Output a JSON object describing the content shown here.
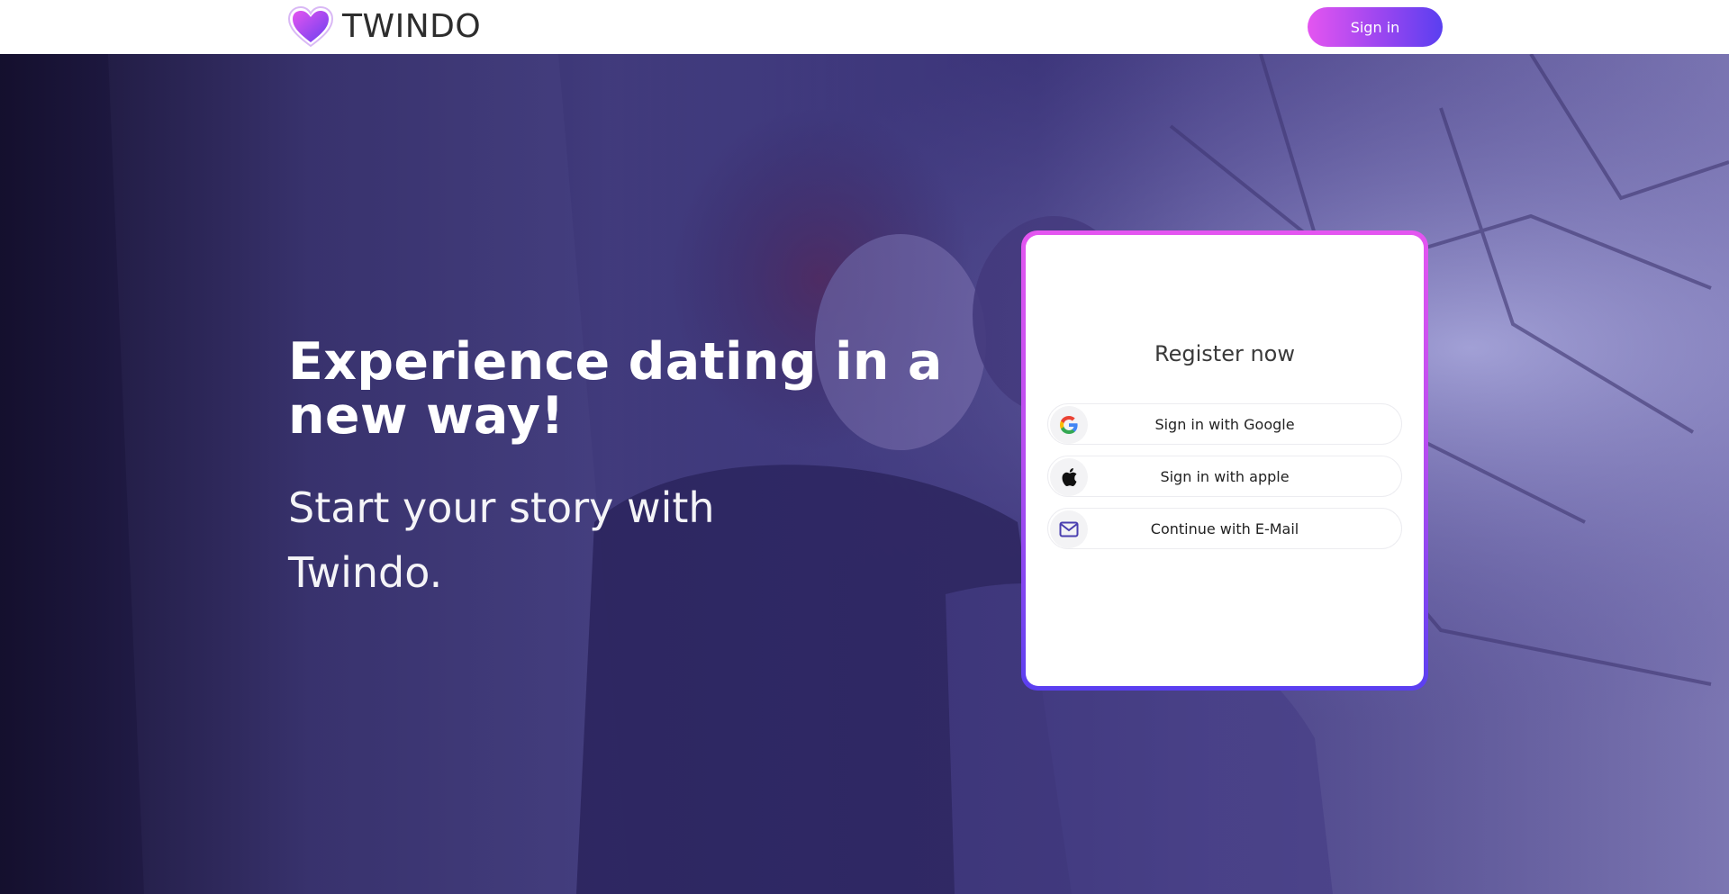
{
  "header": {
    "brand_name": "TWINDO",
    "logo_icon": "heart-icon",
    "signin_label": "Sign in"
  },
  "hero": {
    "headline": "Experience dating in a new way!",
    "subline": "Start your story with Twindo.",
    "background_image": "couple-photo"
  },
  "register": {
    "title": "Register now",
    "buttons": [
      {
        "label": "Sign in with Google",
        "icon": "google-icon"
      },
      {
        "label": "Sign in with apple",
        "icon": "apple-icon"
      },
      {
        "label": "Continue with E-Mail",
        "icon": "mail-icon"
      }
    ]
  },
  "colors": {
    "accent_start": "#e455f0",
    "accent_end": "#5a3ff0",
    "header_bg": "#ffffff",
    "overlay": "#2d2664"
  }
}
